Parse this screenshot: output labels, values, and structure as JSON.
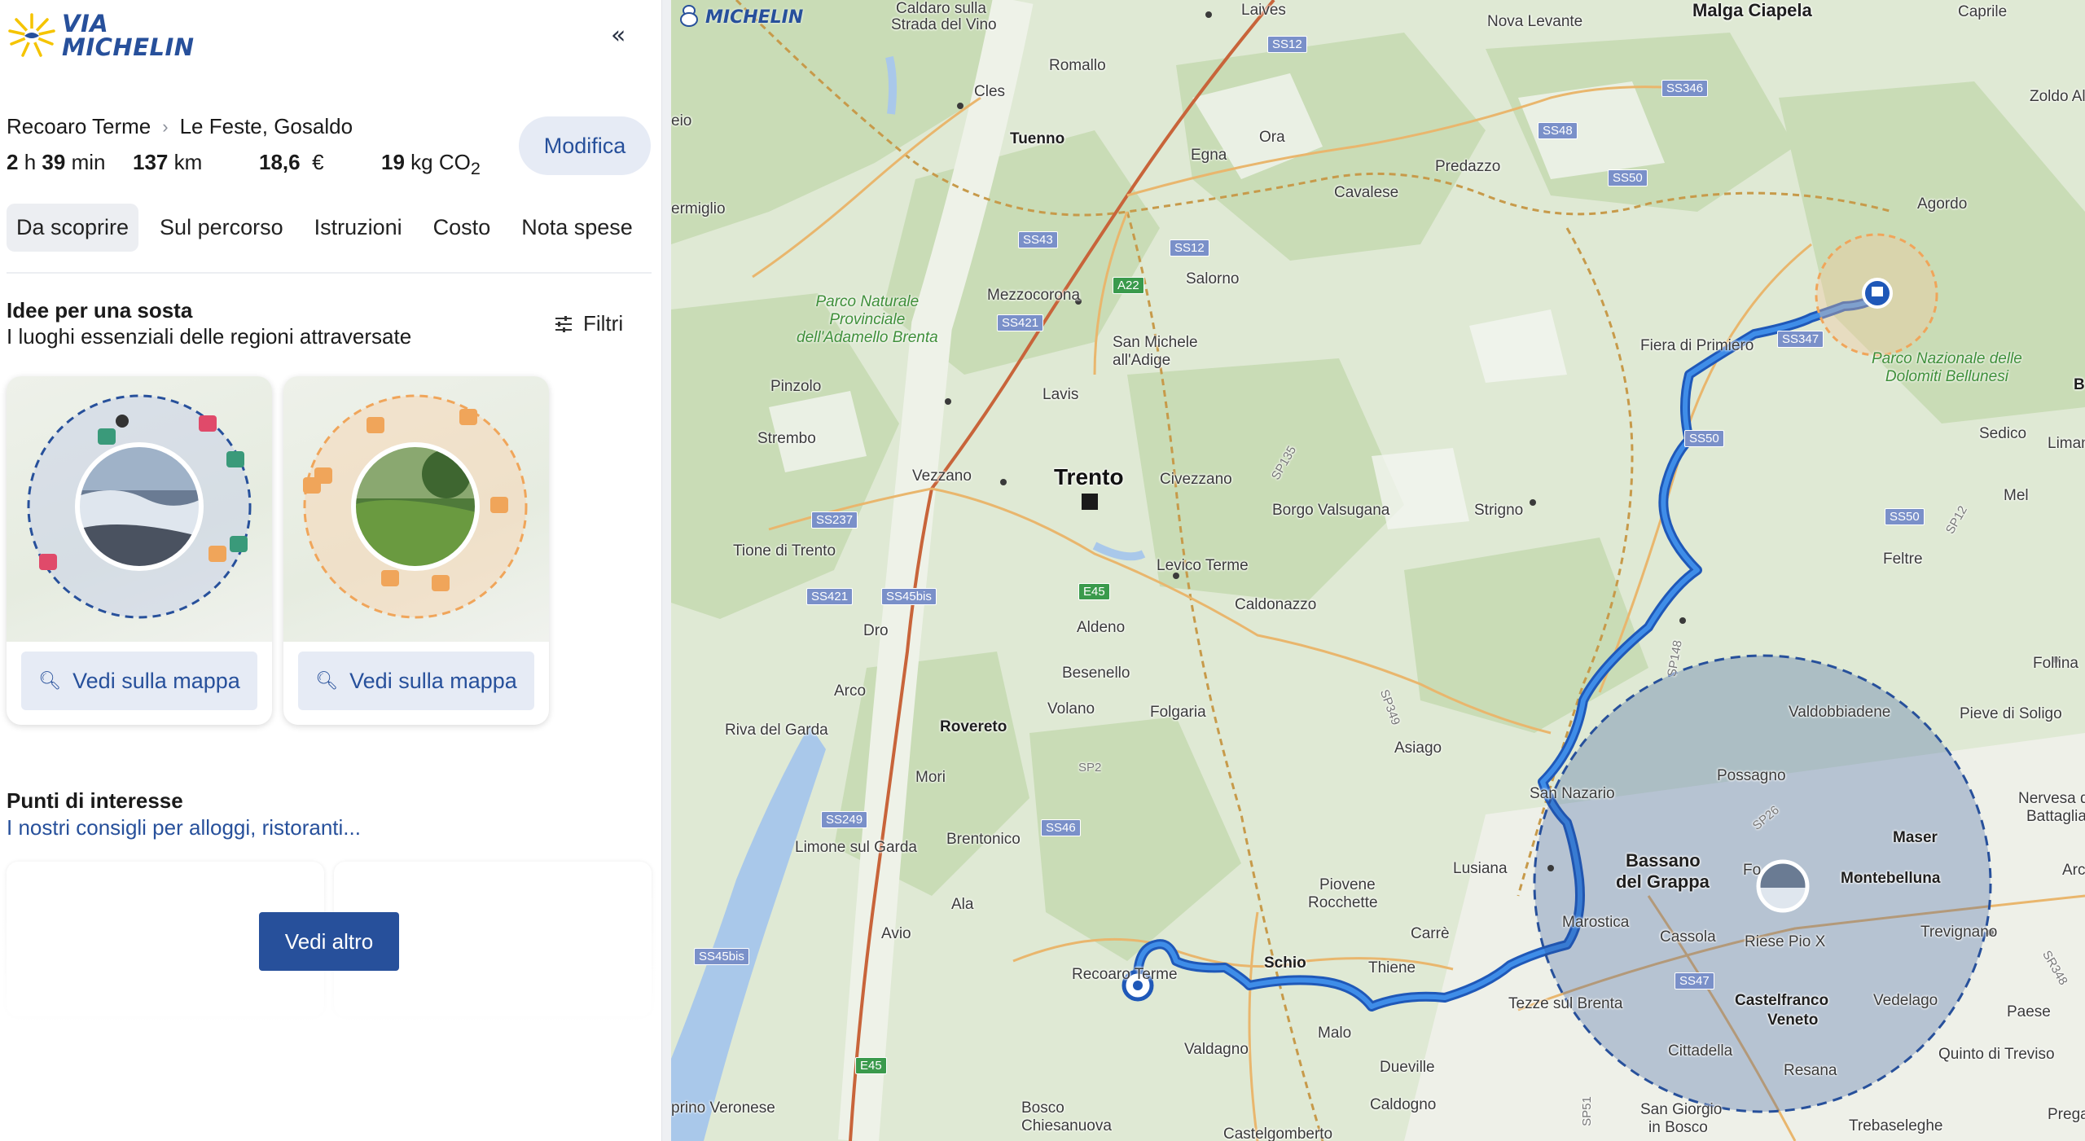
{
  "brand": {
    "name_line1": "VIA",
    "name_line2": "MICHELIN",
    "map_watermark": "MICHELIN"
  },
  "panel": {
    "collapse_label": "«",
    "route": {
      "from": "Recoaro Terme",
      "to": "Le Feste, Gosaldo"
    },
    "stats": {
      "hours": "2",
      "hours_unit": "h",
      "minutes": "39",
      "minutes_unit": "min",
      "distance": "137",
      "distance_unit": "km",
      "cost": "18,6",
      "cost_unit": "€",
      "co2": "19",
      "co2_unit": "kg CO",
      "co2_sub": "2"
    },
    "modify_button": "Modifica",
    "tabs": [
      {
        "label": "Da scoprire",
        "active": true
      },
      {
        "label": "Sul percorso",
        "active": false
      },
      {
        "label": "Istruzioni",
        "active": false
      },
      {
        "label": "Costo",
        "active": false
      },
      {
        "label": "Nota spese",
        "active": false
      }
    ],
    "ideas": {
      "title": "Idee per una sosta",
      "subtitle": "I luoghi essenziali delle regioni attraversate",
      "filter_label": "Filtri",
      "cards": [
        {
          "button": "Vedi sulla mappa",
          "ring_color": "#27509b"
        },
        {
          "button": "Vedi sulla mappa",
          "ring_color": "#f0a55a"
        }
      ]
    },
    "poi": {
      "title": "Punti di interesse",
      "subtitle": "I nostri consigli per alloggi, ristoranti...",
      "more_button": "Vedi altro"
    }
  },
  "map": {
    "route_color": "#2a6fd6",
    "places": {
      "caldaro": "Caldaro sulla",
      "strada_vino": "Strada del Vino",
      "laives": "Laives",
      "nova_levante": "Nova Levante",
      "malga_ciapela": "Malga Ciapela",
      "caprile": "Caprile",
      "zoldo": "Zoldo Al",
      "romallo": "Romallo",
      "cles": "Cles",
      "tuenno": "Tuenno",
      "ora": "Ora",
      "egna": "Egna",
      "predazzo": "Predazzo",
      "cavalese": "Cavalese",
      "agordo": "Agordo",
      "ermiglio": "ermiglio",
      "salorno": "Salorno",
      "mezzocorona": "Mezzocorona",
      "san_michele": "San Michele",
      "all_adige": "all'Adige",
      "fiera": "Fiera di Primiero",
      "pinzolo": "Pinzolo",
      "lavis": "Lavis",
      "strembo": "Strembo",
      "sedico": "Sedico",
      "limana": "Limana",
      "trento": "Trento",
      "vezzano": "Vezzano",
      "civezzano": "Civezzano",
      "borgo": "Borgo Valsugana",
      "strigno": "Strigno",
      "mel": "Mel",
      "tione": "Tione di Trento",
      "levico": "Levico Terme",
      "caldonazzo": "Caldonazzo",
      "feltre": "Feltre",
      "dro": "Dro",
      "aldeno": "Aldeno",
      "follina": "Follina",
      "arco": "Arco",
      "besenello": "Besenello",
      "valdobbiadene": "Valdobbiadene",
      "pieve": "Pieve di Soligo",
      "riva": "Riva del Garda",
      "rovereto": "Rovereto",
      "volano": "Volano",
      "folgaria": "Folgaria",
      "asiago": "Asiago",
      "mori": "Mori",
      "possagno": "Possagno",
      "san_nazario": "San Nazario",
      "nervesa": "Nervesa della",
      "battaglia": "Battaglia",
      "limone": "Limone sul Garda",
      "brentonico": "Brentonico",
      "maser": "Maser",
      "bassano1": "Bassano",
      "bassano2": "del Grappa",
      "lusiana": "Lusiana",
      "montebelluna": "Montebelluna",
      "arca": "Arca",
      "piovene": "Piovene",
      "rocchette": "Rocchette",
      "ala": "Ala",
      "marostica": "Marostica",
      "avio": "Avio",
      "carre": "Carrè",
      "cassola": "Cassola",
      "riese": "Riese Pio X",
      "trevignano": "Trevignano",
      "schio": "Schio",
      "thiene": "Thiene",
      "recoaro": "Recoaro Terme",
      "tezze": "Tezze sul Brenta",
      "castelfranco1": "Castelfranco",
      "castelfranco2": "Veneto",
      "vedelago": "Vedelago",
      "paese": "Paese",
      "malo": "Malo",
      "valdagno": "Valdagno",
      "cittadella": "Cittadella",
      "quinto": "Quinto di Treviso",
      "dueville": "Dueville",
      "resana": "Resana",
      "prino": "prino Veronese",
      "bosco1": "Bosco",
      "bosco2": "Chiesanuova",
      "caldogno": "Caldogno",
      "sangiorgio1": "San Giorgio",
      "sangiorgio2": "in Bosco",
      "trebaseleghe": "Trebaseleghe",
      "prega": "Prega",
      "castelgomberto": "Castelgomberto",
      "fo": "Fo",
      "eio": "eio",
      "b_edge": "B"
    },
    "parks": {
      "adamello": [
        "Parco Naturale",
        "Provinciale",
        "dell'Adamello Brenta"
      ],
      "dolomiti": [
        "Parco Nazionale delle",
        "Dolomiti Bellunesi"
      ]
    },
    "roads": {
      "ss12a": "SS12",
      "ss346": "SS346",
      "ss48": "SS48",
      "ss50a": "SS50",
      "ss43": "SS43",
      "ss12b": "SS12",
      "a22": "A22",
      "ss421a": "SS421",
      "ss347": "SS347",
      "ss50b": "SS50",
      "ss237": "SS237",
      "sp135": "SP135",
      "ss50c": "SS50",
      "sp12": "SP12",
      "ss421b": "SS421",
      "ss45bis": "SS45bis",
      "e45a": "E45",
      "sp148": "SP148",
      "sp349": "SP349",
      "sp2": "SP2",
      "ss249": "SS249",
      "ss46": "SS46",
      "sp26": "SP26",
      "ss45bis2": "SS45bis",
      "ss47": "SS47",
      "sr348": "SR348",
      "e45b": "E45",
      "sp51": "SP51"
    }
  }
}
